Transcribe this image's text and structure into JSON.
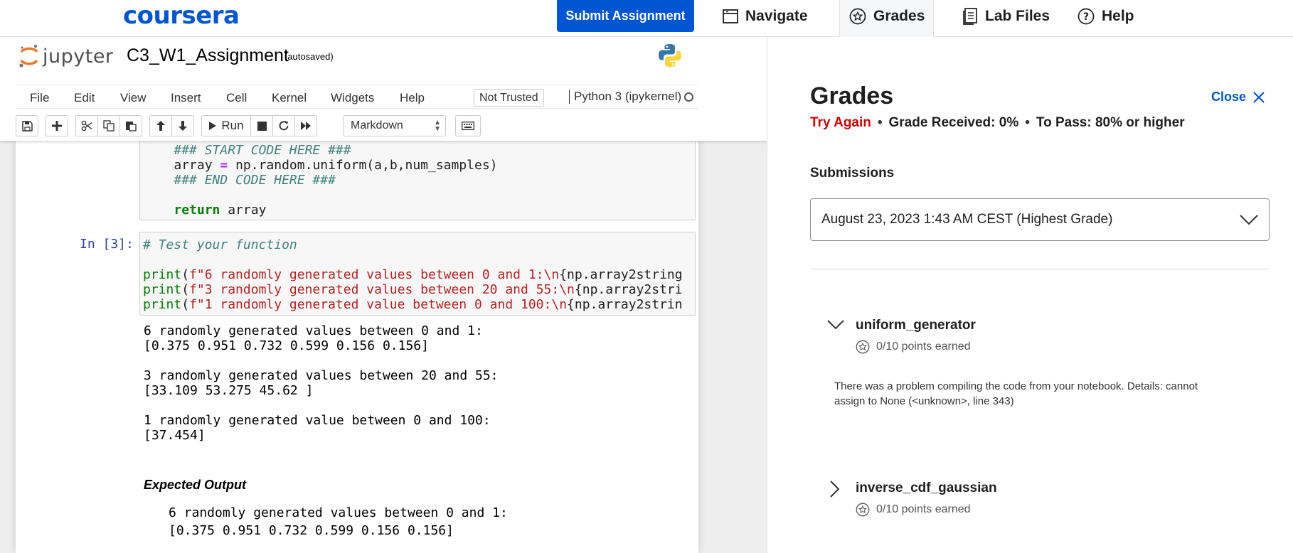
{
  "coursera": {
    "logo": "coursera",
    "submit_label": "Submit Assignment",
    "nav": {
      "navigate": "Navigate",
      "grades": "Grades",
      "lab_files": "Lab Files",
      "help": "Help"
    }
  },
  "jupyter": {
    "brand": "jupyter",
    "notebook_title": "C3_W1_Assignment",
    "autosave": "(autosaved)",
    "menu": [
      "File",
      "Edit",
      "View",
      "Insert",
      "Cell",
      "Kernel",
      "Widgets",
      "Help"
    ],
    "not_trusted": "Not Trusted",
    "kernel": "Python 3 (ipykernel)",
    "toolbar": {
      "run_label": "Run",
      "cell_type": "Markdown"
    },
    "cell1_lines": [
      "### START CODE HERE ###",
      "### END CODE HERE ###"
    ],
    "cell1_code": {
      "var": "array",
      "op": "=",
      "call": "np.random.uniform(a,b,num_samples)",
      "ret_kw": "return",
      "ret_val": "array"
    },
    "cell2_prompt": "In [3]:",
    "cell2_comment": "# Test your function",
    "cell2_prints": [
      {
        "fn": "print",
        "open": "(",
        "str": "f\"6 randomly generated values between 0 and 1:\\n",
        "rest": "{np.array2string"
      },
      {
        "fn": "print",
        "open": "(",
        "str": "f\"3 randomly generated values between 20 and 55:\\n",
        "rest": "{np.array2stri"
      },
      {
        "fn": "print",
        "open": "(",
        "str": "f\"1 randomly generated value between 0 and 100:\\n",
        "rest": "{np.array2strin"
      }
    ],
    "output": "6 randomly generated values between 0 and 1:\n[0.375 0.951 0.732 0.599 0.156 0.156]\n\n3 randomly generated values between 20 and 55:\n[33.109 53.275 45.62 ]\n\n1 randomly generated value between 0 and 100:\n[37.454]",
    "expected_title": "Expected Output",
    "expected_output": "6 randomly generated values between 0 and 1:\n[0.375 0.951 0.732 0.599 0.156 0.156]"
  },
  "grades_panel": {
    "title": "Grades",
    "close_label": "Close",
    "status": "Try Again",
    "grade_received": "Grade Received: 0%",
    "to_pass": "To Pass: 80% or higher",
    "submissions_label": "Submissions",
    "selected_submission": "August 23, 2023 1:43 AM CEST (Highest Grade)",
    "items": [
      {
        "name": "uniform_generator",
        "points": "0/10 points earned",
        "feedback": "There was a problem compiling the code from your notebook. Details: cannot assign to None (<unknown>, line 343)"
      },
      {
        "name": "inverse_cdf_gaussian",
        "points": "0/10 points earned"
      }
    ]
  },
  "colors": {
    "brand_blue": "#0056d2",
    "error_red": "#d30001",
    "prompt_blue": "#303f9f"
  }
}
